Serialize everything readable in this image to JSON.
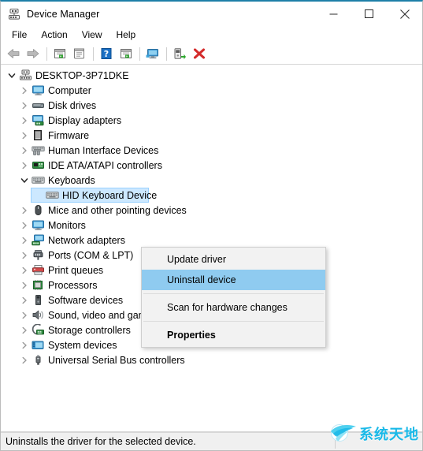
{
  "window": {
    "title": "Device Manager",
    "icon": "device-manager-icon",
    "caption_buttons": [
      {
        "name": "minimize-button",
        "glyph": "minimize-icon"
      },
      {
        "name": "maximize-button",
        "glyph": "maximize-icon"
      },
      {
        "name": "close-button",
        "glyph": "close-icon"
      }
    ]
  },
  "menubar": {
    "items": [
      {
        "label": "File"
      },
      {
        "label": "Action"
      },
      {
        "label": "View"
      },
      {
        "label": "Help"
      }
    ]
  },
  "toolbar": {
    "buttons": [
      {
        "name": "back-button",
        "icon": "back-arrow-icon"
      },
      {
        "name": "forward-button",
        "icon": "forward-arrow-icon"
      },
      {
        "name": "separator-1",
        "icon": "separator"
      },
      {
        "name": "show-hide-console-tree-button",
        "icon": "console-tree-icon"
      },
      {
        "name": "properties-button",
        "icon": "properties-icon"
      },
      {
        "name": "separator-2",
        "icon": "separator"
      },
      {
        "name": "help-button",
        "icon": "help-question-icon"
      },
      {
        "name": "device-list-button",
        "icon": "device-list-icon"
      },
      {
        "name": "separator-3",
        "icon": "separator"
      },
      {
        "name": "scan-hardware-changes-button",
        "icon": "monitor-scan-icon"
      },
      {
        "name": "separator-4",
        "icon": "separator"
      },
      {
        "name": "update-driver-button",
        "icon": "update-driver-icon"
      },
      {
        "name": "uninstall-device-button",
        "icon": "red-x-icon"
      }
    ]
  },
  "tree": {
    "nodes": [
      {
        "label": "DESKTOP-3P71DKE",
        "depth": 0,
        "state": "expanded",
        "icon": "computer-root-icon",
        "selected": false
      },
      {
        "label": "Computer",
        "depth": 1,
        "state": "collapsed",
        "icon": "computer-icon",
        "selected": false
      },
      {
        "label": "Disk drives",
        "depth": 1,
        "state": "collapsed",
        "icon": "disk-drive-icon",
        "selected": false
      },
      {
        "label": "Display adapters",
        "depth": 1,
        "state": "collapsed",
        "icon": "display-adapter-icon",
        "selected": false
      },
      {
        "label": "Firmware",
        "depth": 1,
        "state": "collapsed",
        "icon": "firmware-chip-icon",
        "selected": false
      },
      {
        "label": "Human Interface Devices",
        "depth": 1,
        "state": "collapsed",
        "icon": "hid-icon",
        "selected": false
      },
      {
        "label": "IDE ATA/ATAPI controllers",
        "depth": 1,
        "state": "collapsed",
        "icon": "ide-controller-icon",
        "selected": false
      },
      {
        "label": "Keyboards",
        "depth": 1,
        "state": "expanded",
        "icon": "keyboard-icon",
        "selected": false
      },
      {
        "label": "HID Keyboard Device",
        "depth": 2,
        "state": "leaf",
        "icon": "keyboard-icon",
        "selected": true
      },
      {
        "label": "Mice and other pointing devices",
        "depth": 1,
        "state": "collapsed",
        "icon": "mouse-icon",
        "selected": false
      },
      {
        "label": "Monitors",
        "depth": 1,
        "state": "collapsed",
        "icon": "monitor-icon",
        "selected": false
      },
      {
        "label": "Network adapters",
        "depth": 1,
        "state": "collapsed",
        "icon": "network-adapter-icon",
        "selected": false
      },
      {
        "label": "Ports (COM & LPT)",
        "depth": 1,
        "state": "collapsed",
        "icon": "port-icon",
        "selected": false
      },
      {
        "label": "Print queues",
        "depth": 1,
        "state": "collapsed",
        "icon": "printer-icon",
        "selected": false
      },
      {
        "label": "Processors",
        "depth": 1,
        "state": "collapsed",
        "icon": "processor-icon",
        "selected": false
      },
      {
        "label": "Software devices",
        "depth": 1,
        "state": "collapsed",
        "icon": "software-device-icon",
        "selected": false
      },
      {
        "label": "Sound, video and game controllers",
        "depth": 1,
        "state": "collapsed",
        "icon": "sound-icon",
        "selected": false
      },
      {
        "label": "Storage controllers",
        "depth": 1,
        "state": "collapsed",
        "icon": "storage-controller-icon",
        "selected": false
      },
      {
        "label": "System devices",
        "depth": 1,
        "state": "collapsed",
        "icon": "system-device-icon",
        "selected": false
      },
      {
        "label": "Universal Serial Bus controllers",
        "depth": 1,
        "state": "collapsed",
        "icon": "usb-icon",
        "selected": false
      }
    ]
  },
  "context_menu": {
    "items": [
      {
        "label": "Update driver",
        "type": "item",
        "highlighted": false,
        "bold": false
      },
      {
        "label": "Uninstall device",
        "type": "item",
        "highlighted": true,
        "bold": false
      },
      {
        "label": "",
        "type": "separator",
        "highlighted": false,
        "bold": false
      },
      {
        "label": "Scan for hardware changes",
        "type": "item",
        "highlighted": false,
        "bold": false
      },
      {
        "label": "",
        "type": "separator",
        "highlighted": false,
        "bold": false
      },
      {
        "label": "Properties",
        "type": "item",
        "highlighted": false,
        "bold": true
      }
    ]
  },
  "statusbar": {
    "text": "Uninstalls the driver for the selected device."
  },
  "watermark": {
    "text": "系统天地",
    "icon": "globe-swoosh-icon"
  },
  "colors": {
    "accent_titlebar": "#1e7fa8",
    "selection": "#cce8ff",
    "menu_highlight": "#8fcbf0",
    "watermark": "#19b9e8",
    "toolbar_red": "#d42b2b",
    "window_bg": "#f0f0f0"
  }
}
